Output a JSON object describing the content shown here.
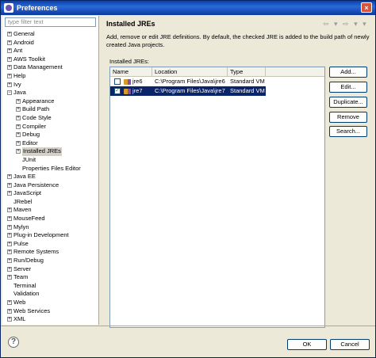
{
  "window": {
    "title": "Preferences",
    "close_icon": "×"
  },
  "filter": {
    "placeholder": "type filter text"
  },
  "tree": [
    {
      "label": "General",
      "depth": 0,
      "exp": "+"
    },
    {
      "label": "Android",
      "depth": 0,
      "exp": "+"
    },
    {
      "label": "Ant",
      "depth": 0,
      "exp": "+"
    },
    {
      "label": "AWS Toolkit",
      "depth": 0,
      "exp": "+"
    },
    {
      "label": "Data Management",
      "depth": 0,
      "exp": "+"
    },
    {
      "label": "Help",
      "depth": 0,
      "exp": "+"
    },
    {
      "label": "Ivy",
      "depth": 0,
      "exp": "+"
    },
    {
      "label": "Java",
      "depth": 0,
      "exp": "−"
    },
    {
      "label": "Appearance",
      "depth": 1,
      "exp": "+"
    },
    {
      "label": "Build Path",
      "depth": 1,
      "exp": "+"
    },
    {
      "label": "Code Style",
      "depth": 1,
      "exp": "+"
    },
    {
      "label": "Compiler",
      "depth": 1,
      "exp": "+"
    },
    {
      "label": "Debug",
      "depth": 1,
      "exp": "+"
    },
    {
      "label": "Editor",
      "depth": 1,
      "exp": "+"
    },
    {
      "label": "Installed JREs",
      "depth": 1,
      "exp": "+",
      "selected": true
    },
    {
      "label": "JUnit",
      "depth": 1,
      "exp": ""
    },
    {
      "label": "Properties Files Editor",
      "depth": 1,
      "exp": ""
    },
    {
      "label": "Java EE",
      "depth": 0,
      "exp": "+"
    },
    {
      "label": "Java Persistence",
      "depth": 0,
      "exp": "+"
    },
    {
      "label": "JavaScript",
      "depth": 0,
      "exp": "+"
    },
    {
      "label": "JRebel",
      "depth": 0,
      "exp": ""
    },
    {
      "label": "Maven",
      "depth": 0,
      "exp": "+"
    },
    {
      "label": "MouseFeed",
      "depth": 0,
      "exp": "+"
    },
    {
      "label": "Mylyn",
      "depth": 0,
      "exp": "+"
    },
    {
      "label": "Plug-in Development",
      "depth": 0,
      "exp": "+"
    },
    {
      "label": "Pulse",
      "depth": 0,
      "exp": "+"
    },
    {
      "label": "Remote Systems",
      "depth": 0,
      "exp": "+"
    },
    {
      "label": "Run/Debug",
      "depth": 0,
      "exp": "+"
    },
    {
      "label": "Server",
      "depth": 0,
      "exp": "+"
    },
    {
      "label": "Team",
      "depth": 0,
      "exp": "+"
    },
    {
      "label": "Terminal",
      "depth": 0,
      "exp": ""
    },
    {
      "label": "Validation",
      "depth": 0,
      "exp": ""
    },
    {
      "label": "Web",
      "depth": 0,
      "exp": "+"
    },
    {
      "label": "Web Services",
      "depth": 0,
      "exp": "+"
    },
    {
      "label": "XML",
      "depth": 0,
      "exp": "+"
    }
  ],
  "page": {
    "heading": "Installed JREs",
    "nav_arrows": "⇦ ▾ ⇨ ▾ ▾",
    "description": "Add, remove or edit JRE definitions. By default, the checked JRE is added to the build path of newly created Java projects.",
    "table_label": "Installed JREs:"
  },
  "table": {
    "columns": [
      "Name",
      "Location",
      "Type"
    ],
    "rows": [
      {
        "name": "jre6",
        "location": "C:\\Program Files\\Java\\jre6",
        "type": "Standard VM",
        "checked": false,
        "selected": false
      },
      {
        "name": "jre7",
        "location": "C:\\Program Files\\Java\\jre7",
        "type": "Standard VM",
        "checked": true,
        "selected": true
      }
    ]
  },
  "buttons": {
    "add": "Add...",
    "edit": "Edit...",
    "duplicate": "Duplicate...",
    "remove": "Remove",
    "search": "Search...",
    "ok": "OK",
    "cancel": "Cancel",
    "help": "?"
  },
  "colors": {
    "selection": "#0a246a",
    "title_bar": "#0a3fa8",
    "dialog_bg": "#ece9d8"
  }
}
